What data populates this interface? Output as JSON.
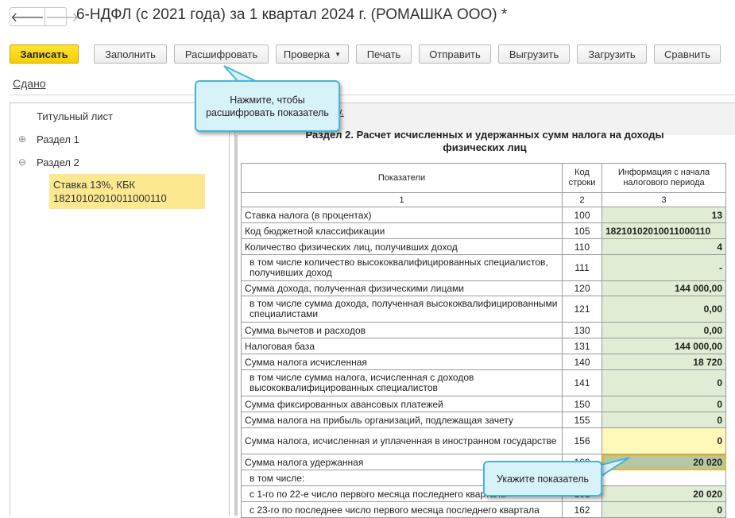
{
  "window": {
    "back_icon": "arrow-left-icon",
    "forward_icon": "arrow-right-icon",
    "title": "6-НДФЛ (с 2021 года) за 1 квартал 2024 г. (РОМАШКА ООО) *"
  },
  "toolbar": {
    "save": "Записать",
    "fill": "Заполнить",
    "decode": "Расшифровать",
    "check": "Проверка",
    "print": "Печать",
    "send": "Отправить",
    "export": "Выгрузить",
    "import": "Загрузить",
    "compare": "Сравнить"
  },
  "status_link": "Сданo",
  "tree": {
    "items": [
      {
        "label": "Титульный лист"
      },
      {
        "toggle": "⊕",
        "label": "Раздел 1"
      },
      {
        "toggle": "⊖",
        "label": "Раздел 2"
      }
    ],
    "selected": {
      "line1": "Ставка 13%, КБК",
      "line2": "18210102010011000110"
    }
  },
  "partial_link": "у.",
  "section_title_line1": "Раздел 2. Расчет исчисленных и удержанных сумм налога на доходы",
  "section_title_line2": "физических лиц",
  "table": {
    "headers": {
      "col1": "Показатели",
      "col2_l1": "Код",
      "col2_l2": "строки",
      "col3_l1": "Информация с начала",
      "col3_l2": "налогового периода"
    },
    "numbers": {
      "col1": "1",
      "col2": "2",
      "col3": "3"
    },
    "rows": [
      {
        "label": "Ставка налога (в процентах)",
        "code": "100",
        "value": "13"
      },
      {
        "label": "Код бюджетной классификации",
        "code": "105",
        "value": "18210102010011000110"
      },
      {
        "label": "Количество физических лиц, получивших доход",
        "code": "110",
        "value": "4"
      },
      {
        "label": "в том числе количество высококвалифицированных специалистов, получивших доход",
        "code": "111",
        "value": "-"
      },
      {
        "label": "Сумма дохода, полученная физическими лицами",
        "code": "120",
        "value": "144 000,00"
      },
      {
        "label": "в том числе сумма дохода, полученная высококвалифицированными специалистами",
        "code": "121",
        "value": "0,00"
      },
      {
        "label": "Сумма вычетов и расходов",
        "code": "130",
        "value": "0,00"
      },
      {
        "label": "Налоговая база",
        "code": "131",
        "value": "144 000,00"
      },
      {
        "label": "Сумма налога исчисленная",
        "code": "140",
        "value": "18 720"
      },
      {
        "label": "в том числе сумма налога, исчисленная с доходов высококвалифицированных специалистов",
        "code": "141",
        "value": "0"
      },
      {
        "label": "Сумма фиксированных авансовых платежей",
        "code": "150",
        "value": "0"
      },
      {
        "label": "Сумма налога на прибыль организаций, подлежащая зачету",
        "code": "155",
        "value": "0"
      },
      {
        "label": "Сумма налога, исчисленная и уплаченная в иностранном государстве",
        "code": "156",
        "value": "0"
      },
      {
        "label": "Сумма налога удержанная",
        "code": "160",
        "value": "20 020"
      },
      {
        "label": "в том числе:",
        "code": "",
        "value": ""
      },
      {
        "label": "с 1-го по 22-е число первого месяца последнего квартала",
        "code": "161",
        "value": "20 020"
      },
      {
        "label": "с 23-го по последнее число первого месяца последнего квартала",
        "code": "162",
        "value": "0"
      }
    ]
  },
  "callouts": {
    "decode_hint": "Нажмите, чтобы расшифровать показатель",
    "select_hint": "Укажите показатель"
  }
}
